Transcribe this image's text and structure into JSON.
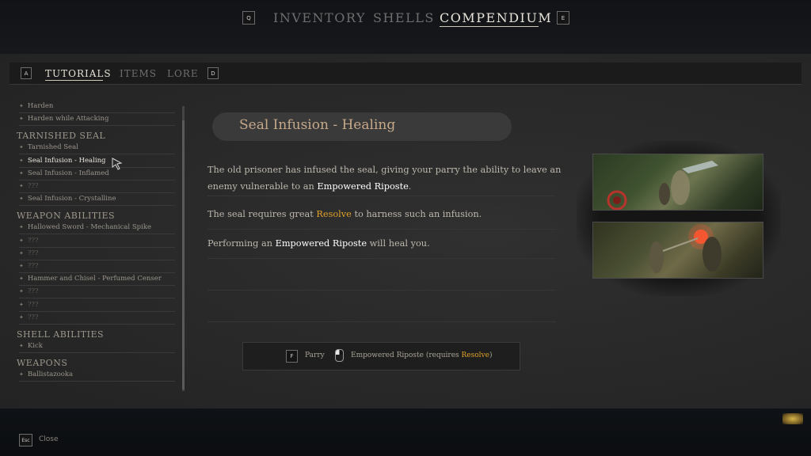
{
  "top_nav": {
    "left_key": "Q",
    "right_key": "E",
    "tabs": [
      {
        "label": "INVENTORY",
        "active": false
      },
      {
        "label": "SHELLS",
        "active": false
      },
      {
        "label": "COMPENDIUM",
        "active": true
      }
    ]
  },
  "sub_nav": {
    "left_key": "A",
    "right_key": "D",
    "tabs": [
      {
        "label": "TUTORIALS",
        "active": true
      },
      {
        "label": "ITEMS",
        "active": false
      },
      {
        "label": "LORE",
        "active": false
      }
    ]
  },
  "list": {
    "items": [
      {
        "label": "Harden"
      },
      {
        "label": "Harden while Attacking"
      },
      {
        "section": "TARNISHED SEAL"
      },
      {
        "label": "Tarnished Seal"
      },
      {
        "label": "Seal Infusion - Healing",
        "selected": true
      },
      {
        "label": "Seal Infusion - Inflamed"
      },
      {
        "label": "???"
      },
      {
        "label": "Seal Infusion - Crystalline"
      },
      {
        "section": "WEAPON ABILITIES"
      },
      {
        "label": "Hallowed Sword - Mechanical Spike"
      },
      {
        "label": "???"
      },
      {
        "label": "???"
      },
      {
        "label": "???"
      },
      {
        "label": "Hammer and Chisel - Perfumed Censer"
      },
      {
        "label": "???"
      },
      {
        "label": "???"
      },
      {
        "label": "???"
      },
      {
        "section": "SHELL ABILITIES"
      },
      {
        "label": "Kick"
      },
      {
        "section": "WEAPONS"
      },
      {
        "label": "Ballistazooka"
      }
    ]
  },
  "detail": {
    "title": "Seal Infusion - Healing",
    "p1_a": "The old prisoner has infused the seal, giving your parry the ability to leave an",
    "p1_b": "enemy vulnerable to an ",
    "p1_hl": "Empowered Riposte",
    "p1_end": ".",
    "p2_a": "The seal requires great ",
    "p2_gold": "Resolve",
    "p2_b": " to harness such an infusion.",
    "p3_a": "Performing an ",
    "p3_hl": "Empowered Riposte",
    "p3_b": " will heal you."
  },
  "controls": {
    "parry_key": "F",
    "parry_label": "Parry",
    "riposte_label": "Empowered Riposte (requires ",
    "riposte_gold": "Resolve",
    "riposte_end": ")"
  },
  "footer": {
    "close_key": "Esc",
    "close_label": "Close"
  },
  "colors": {
    "accent_gold": "#e0a12a",
    "title_tan": "#c5a98a"
  }
}
